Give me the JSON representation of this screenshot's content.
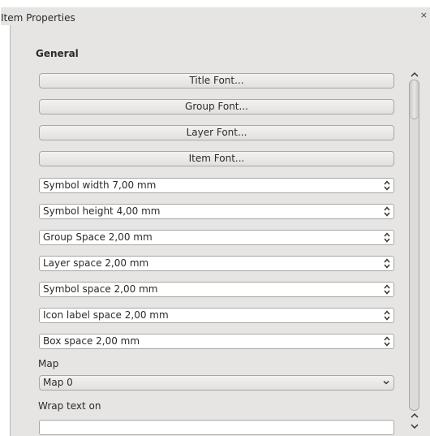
{
  "panel": {
    "title": "Item Properties",
    "close_label": "×"
  },
  "general": {
    "section_title": "General",
    "font_buttons": [
      "Title Font...",
      "Group Font...",
      "Layer Font...",
      "Item Font..."
    ],
    "spin_fields": [
      "Symbol width 7,00 mm",
      "Symbol height 4,00 mm",
      "Group Space 2,00 mm",
      "Layer space 2,00 mm",
      "Symbol space 2,00 mm",
      "Icon label space 2,00 mm",
      "Box space 2,00 mm"
    ],
    "map_label": "Map",
    "map_value": "Map 0",
    "wrap_label": "Wrap text on",
    "wrap_value": ""
  }
}
